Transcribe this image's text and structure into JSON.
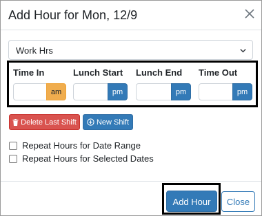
{
  "dialog": {
    "title": "Add Hour for Mon, 12/9",
    "close_icon": "close-x-icon"
  },
  "hour_type": {
    "selected": "Work Hrs"
  },
  "time_fields": [
    {
      "label": "Time In",
      "value": "",
      "period": "am"
    },
    {
      "label": "Lunch Start",
      "value": "",
      "period": "pm"
    },
    {
      "label": "Lunch End",
      "value": "",
      "period": "pm"
    },
    {
      "label": "Time Out",
      "value": "",
      "period": "pm"
    }
  ],
  "shift_buttons": {
    "delete_label": "Delete Last Shift",
    "delete_icon": "trash-icon",
    "new_label": "New Shift",
    "new_icon": "plus-circle-icon"
  },
  "options": [
    {
      "label": "Repeat Hours for Date Range",
      "checked": false
    },
    {
      "label": "Repeat Hours for Selected Dates",
      "checked": false
    }
  ],
  "footer": {
    "add_label": "Add Hour",
    "close_label": "Close"
  },
  "colors": {
    "primary": "#337ab7",
    "danger": "#d9534f",
    "am": "#f0ad4e"
  }
}
